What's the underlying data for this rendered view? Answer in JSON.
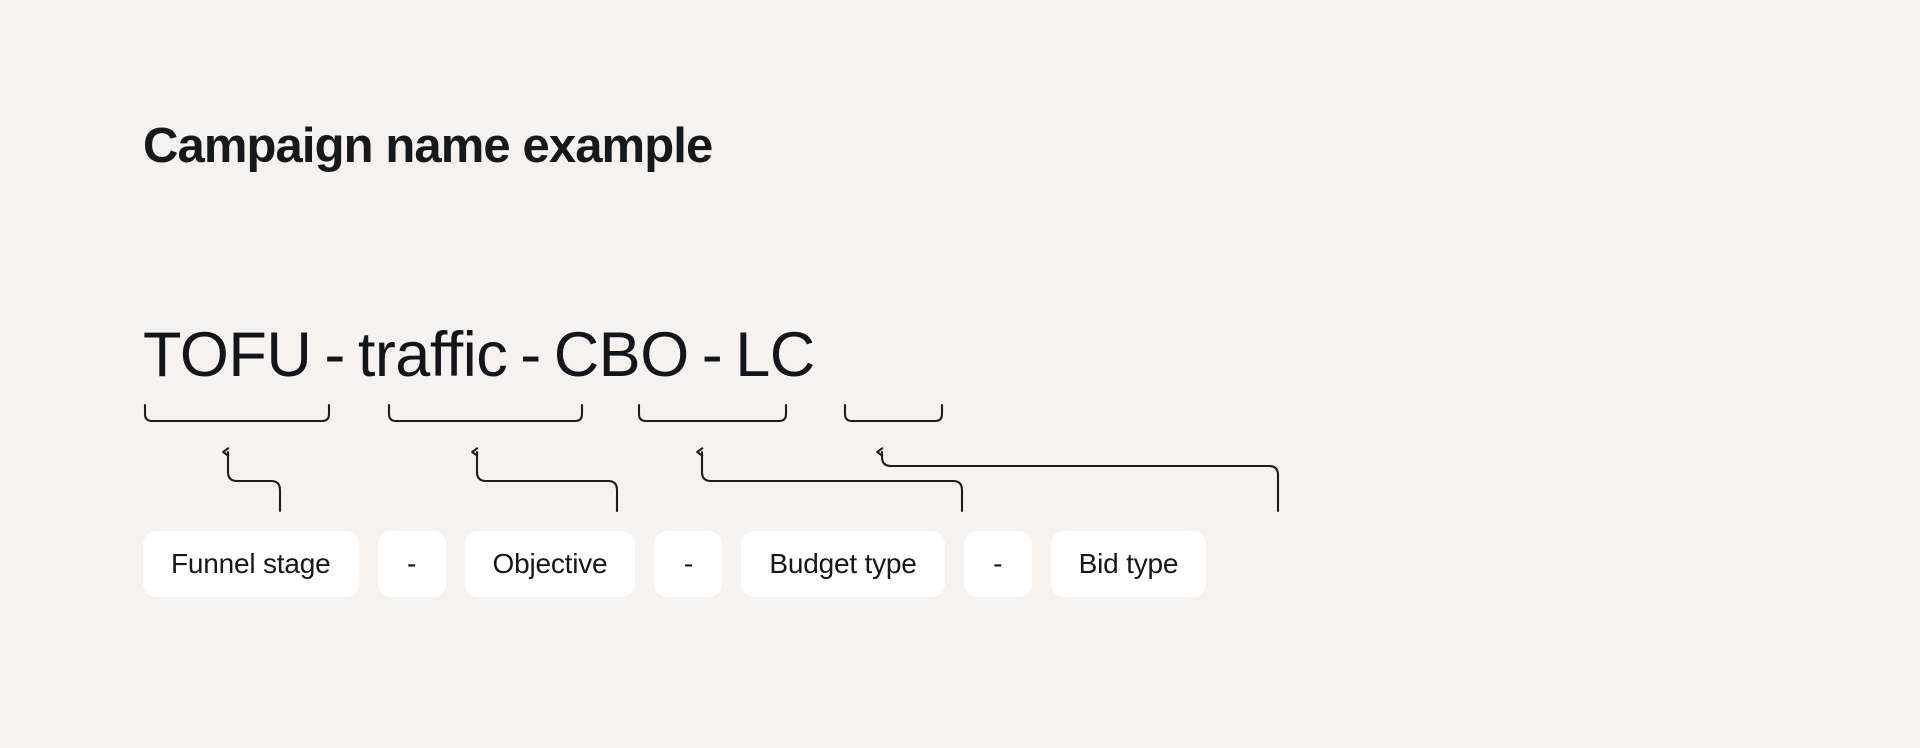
{
  "theme": {
    "background": "#f5f2f0",
    "pill_background": "#ffffff",
    "text_color": "#17181a",
    "connector_color": "#1d1d1f"
  },
  "header": {
    "title": "Campaign name example"
  },
  "formula": {
    "separator": "-",
    "full_text": "TOFU - traffic - CBO - LC",
    "segments": [
      {
        "text": "TOFU",
        "label": "Funnel stage"
      },
      {
        "text": "traffic",
        "label": "Objective"
      },
      {
        "text": "CBO",
        "label": "Budget type"
      },
      {
        "text": "LC",
        "label": "Bid type"
      }
    ]
  },
  "legend": {
    "pills": [
      {
        "text": "Funnel stage",
        "kind": "term"
      },
      {
        "text": "-",
        "kind": "dash"
      },
      {
        "text": "Objective",
        "kind": "term"
      },
      {
        "text": "-",
        "kind": "dash"
      },
      {
        "text": "Budget type",
        "kind": "term"
      },
      {
        "text": "-",
        "kind": "dash"
      },
      {
        "text": "Bid type",
        "kind": "term"
      }
    ]
  },
  "connectors": [
    {
      "name": "funnel-stage-connector",
      "from": "TOFU",
      "to": "Funnel stage"
    },
    {
      "name": "objective-connector",
      "from": "traffic",
      "to": "Objective"
    },
    {
      "name": "budget-type-connector",
      "from": "CBO",
      "to": "Budget type"
    },
    {
      "name": "bid-type-connector",
      "from": "LC",
      "to": "Bid type"
    }
  ]
}
